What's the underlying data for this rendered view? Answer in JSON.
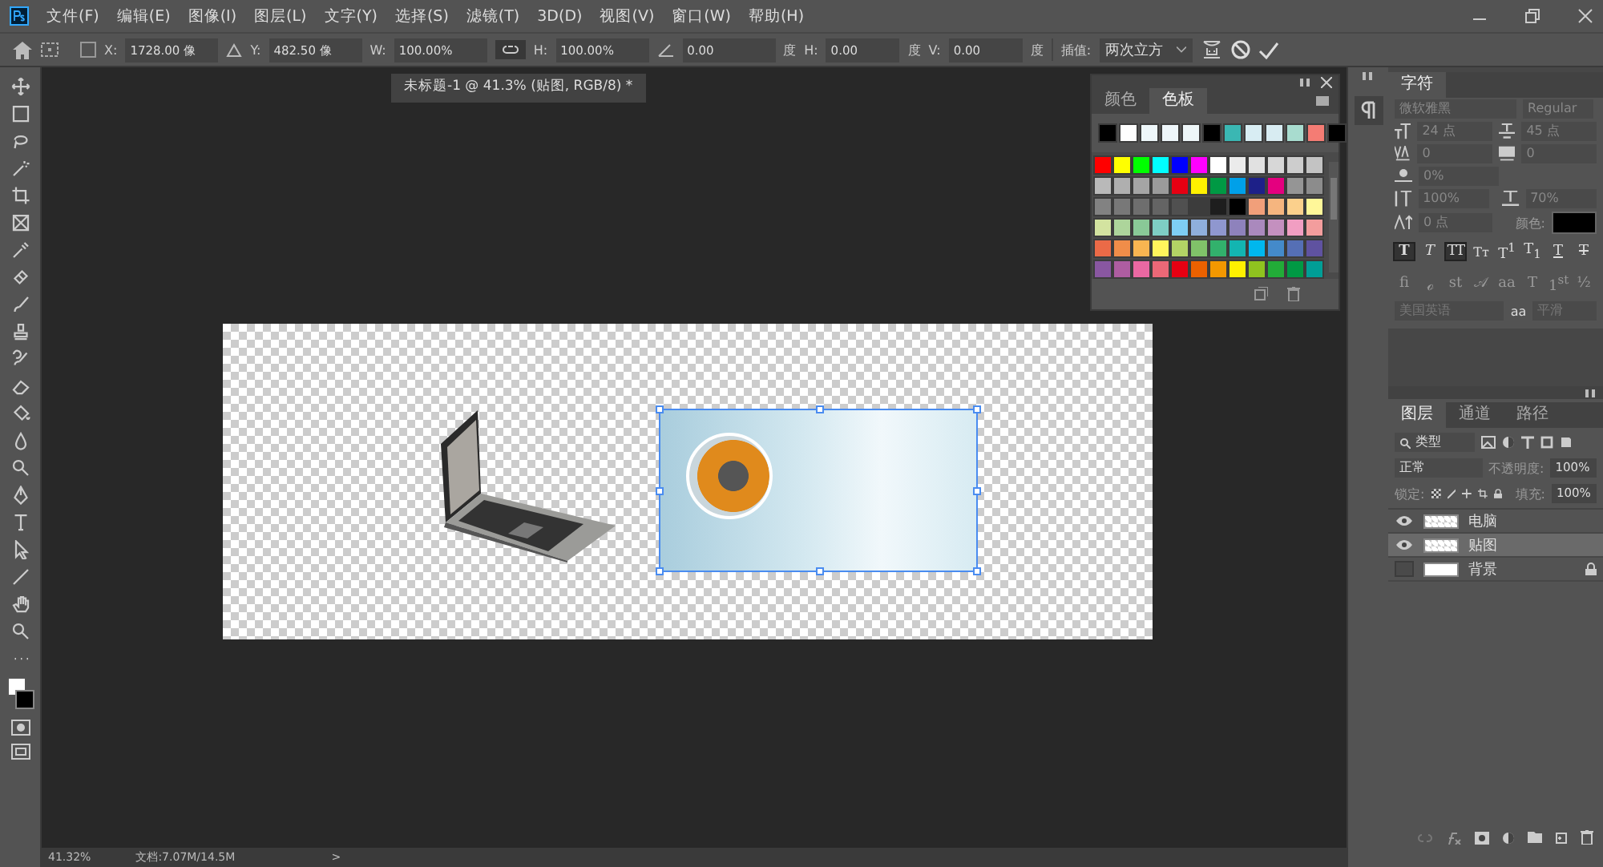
{
  "menu": [
    "文件(F)",
    "编辑(E)",
    "图像(I)",
    "图层(L)",
    "文字(Y)",
    "选择(S)",
    "滤镜(T)",
    "3D(D)",
    "视图(V)",
    "窗口(W)",
    "帮助(H)"
  ],
  "options": {
    "use_reference_point": false,
    "x": {
      "label": "X:",
      "value": "1728.00 像"
    },
    "y": {
      "label": "Y:",
      "value": "482.50 像"
    },
    "w": {
      "label": "W:",
      "value": "100.00%"
    },
    "link_on": true,
    "h": {
      "label": "H:",
      "value": "100.00%"
    },
    "angle": {
      "value": "0.00",
      "unit": "度"
    },
    "skew_h": {
      "label": "H:",
      "value": "0.00",
      "unit": "度"
    },
    "skew_v": {
      "label": "V:",
      "value": "0.00",
      "unit": "度"
    },
    "interpolation": {
      "label": "插值:",
      "value": "两次立方"
    }
  },
  "document": {
    "tab_title": "未标题-1 @ 41.3% (贴图, RGB/8) *"
  },
  "swatches_panel": {
    "tabs": [
      {
        "label": "颜色",
        "selected": false
      },
      {
        "label": "色板",
        "selected": true
      }
    ],
    "recent": [
      {
        "color": "#000000"
      },
      {
        "color": "#ffffff"
      },
      {
        "color": "#eef7fa"
      },
      {
        "color": "#eef6fa"
      },
      {
        "color": "#eef6f8"
      },
      {
        "color": "#000000"
      },
      {
        "color": "#3ab7b3"
      },
      {
        "color": "#d8edf3"
      },
      {
        "color": "#d8ecf2"
      },
      {
        "color": "#a8dccf"
      },
      {
        "color": "#f47c74"
      },
      {
        "color": "#000000"
      }
    ],
    "grid": [
      {
        "color": "#ff0000"
      },
      {
        "color": "#ffff00"
      },
      {
        "color": "#00ff00"
      },
      {
        "color": "#00ffff"
      },
      {
        "color": "#0000ff"
      },
      {
        "color": "#ff00ff"
      },
      {
        "color": "#ffffff"
      },
      {
        "color": "#ebebeb"
      },
      {
        "color": "#e1e1e1"
      },
      {
        "color": "#d7d7d7"
      },
      {
        "color": "#cdcdcd"
      },
      {
        "color": "#c3c3c3"
      },
      {
        "color": "#b9b9b9"
      },
      {
        "color": "#afafaf"
      },
      {
        "color": "#a5a5a5"
      },
      {
        "color": "#9b9b9b"
      },
      {
        "color": "#e60012"
      },
      {
        "color": "#fff100"
      },
      {
        "color": "#009944"
      },
      {
        "color": "#00a0e9"
      },
      {
        "color": "#1d2088"
      },
      {
        "color": "#e4007f"
      },
      {
        "color": "#959595"
      },
      {
        "color": "#8c8c8c"
      },
      {
        "color": "#828282"
      },
      {
        "color": "#787878"
      },
      {
        "color": "#6e6e6e"
      },
      {
        "color": "#646464"
      },
      {
        "color": "#505050"
      },
      {
        "color": "#3c3c3c"
      },
      {
        "color": "#1e1e1e"
      },
      {
        "color": "#000000"
      },
      {
        "color": "#f19f7a"
      },
      {
        "color": "#f5b57f"
      },
      {
        "color": "#fbd08c"
      },
      {
        "color": "#fff799"
      },
      {
        "color": "#d3e3a0"
      },
      {
        "color": "#add59b"
      },
      {
        "color": "#89c997"
      },
      {
        "color": "#7ecec4"
      },
      {
        "color": "#7ecef4"
      },
      {
        "color": "#8fafdc"
      },
      {
        "color": "#8f97cf"
      },
      {
        "color": "#8e82bc"
      },
      {
        "color": "#aa89bd"
      },
      {
        "color": "#c490bf"
      },
      {
        "color": "#f19ec2"
      },
      {
        "color": "#f39d9d"
      },
      {
        "color": "#eb6a47"
      },
      {
        "color": "#f08d49"
      },
      {
        "color": "#f8b551"
      },
      {
        "color": "#fff45c"
      },
      {
        "color": "#b3d465"
      },
      {
        "color": "#80c269"
      },
      {
        "color": "#32b16c"
      },
      {
        "color": "#13b5b1"
      },
      {
        "color": "#00b7ee"
      },
      {
        "color": "#448aca"
      },
      {
        "color": "#556fb5"
      },
      {
        "color": "#5f52a0"
      },
      {
        "color": "#8957a1"
      },
      {
        "color": "#ae5da1"
      },
      {
        "color": "#ea68a2"
      },
      {
        "color": "#eb6877"
      },
      {
        "color": "#e60012"
      },
      {
        "color": "#eb6100"
      },
      {
        "color": "#f39800"
      },
      {
        "color": "#fff100"
      },
      {
        "color": "#8fc31f"
      },
      {
        "color": "#22ac38"
      },
      {
        "color": "#009944"
      },
      {
        "color": "#009e96"
      }
    ]
  },
  "character_panel": {
    "tab": "字符",
    "font": "微软雅黑",
    "style": "Regular",
    "size": "24 点",
    "leading": "45 点",
    "kerning": "0",
    "tracking": "0",
    "tsume": "0%",
    "vertical_scale": "100%",
    "horizontal_scale": "70%",
    "baseline_shift": "0 点",
    "color_label": "颜色:",
    "color": "#000000",
    "type_styles": [
      {
        "kind": "bold",
        "label": "T",
        "selected": true
      },
      {
        "kind": "italic",
        "label": "T",
        "selected": false
      },
      {
        "kind": "caps",
        "label": "TT",
        "selected": true
      },
      {
        "kind": "smallcaps",
        "label": "Tт",
        "selected": false
      },
      {
        "kind": "super",
        "label": "T$^{1}$",
        "selected": false
      },
      {
        "kind": "sub",
        "label": "T$_{1}$",
        "selected": false
      },
      {
        "kind": "underline",
        "label": "T",
        "selected": false
      },
      {
        "kind": "strike",
        "label": "T",
        "selected": false
      }
    ],
    "opentype": [
      "fi",
      "ℴ",
      "st",
      "𝒜",
      "aa",
      "T",
      "1$^{st}$",
      "½"
    ],
    "language": "美国英语",
    "aa_label": "aa",
    "antialias": "平滑"
  },
  "layers_panel": {
    "tabs": [
      {
        "label": "图层",
        "selected": true
      },
      {
        "label": "通道",
        "selected": false
      },
      {
        "label": "路径",
        "selected": false
      }
    ],
    "filter": "类型",
    "blend_mode": "正常",
    "opacity_label": "不透明度:",
    "opacity": "100%",
    "lock_label": "锁定:",
    "fill_label": "填充:",
    "fill": "100%",
    "layers": [
      {
        "name": "电脑",
        "visible": true,
        "selected": false,
        "locked": false
      },
      {
        "name": "贴图",
        "visible": true,
        "selected": true,
        "locked": false
      },
      {
        "name": "背景",
        "visible": false,
        "selected": false,
        "locked": true
      }
    ]
  },
  "status_bar": {
    "zoom": "41.32%",
    "doc_size": "文档:7.07M/14.5M",
    "arrow": ">"
  }
}
